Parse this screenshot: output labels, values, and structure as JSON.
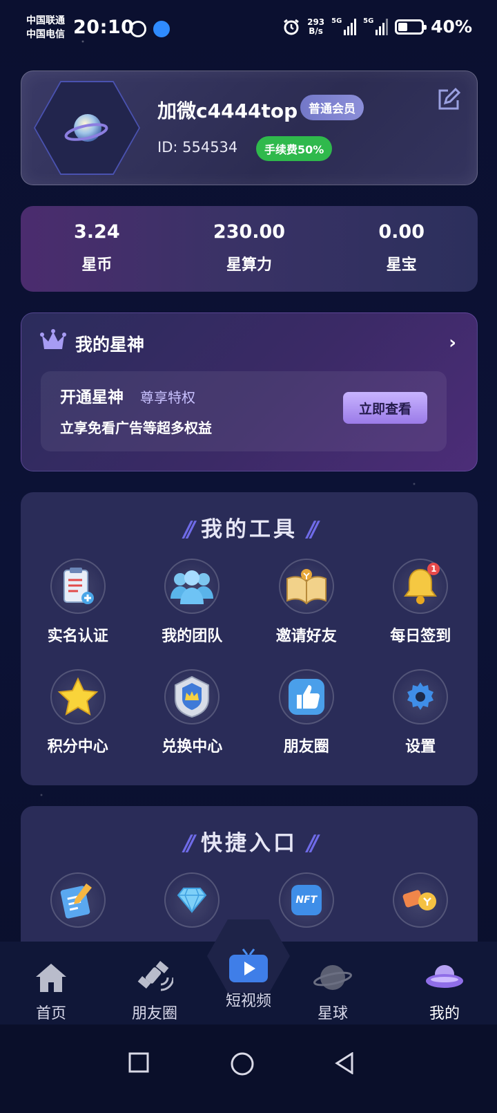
{
  "status_bar": {
    "carrier1": "中国联通",
    "carrier2": "中国电信",
    "time": "20:10",
    "net_speed_value": "293",
    "net_speed_unit": "B/s",
    "signal1_label": "5G",
    "signal2_label": "5G",
    "battery": "40%"
  },
  "profile": {
    "username": "加微c4444top",
    "member_level": "普通会员",
    "user_id": "ID: 554534",
    "fee": "手续费50%"
  },
  "stats": [
    {
      "value": "3.24",
      "label": "星币"
    },
    {
      "value": "230.00",
      "label": "星算力"
    },
    {
      "value": "0.00",
      "label": "星宝"
    }
  ],
  "vip": {
    "title": "我的星神",
    "inner_title": "开通星神",
    "inner_subtitle": "尊享特权",
    "description": "立享免看广告等超多权益",
    "button": "立即查看"
  },
  "tools": {
    "title": "我的工具",
    "items": [
      {
        "label": "实名认证",
        "icon": "clipboard-icon"
      },
      {
        "label": "我的团队",
        "icon": "team-icon"
      },
      {
        "label": "邀请好友",
        "icon": "book-icon"
      },
      {
        "label": "每日签到",
        "icon": "bell-icon",
        "badge": "1"
      },
      {
        "label": "积分中心",
        "icon": "star-icon"
      },
      {
        "label": "兑换中心",
        "icon": "crown-shield-icon"
      },
      {
        "label": "朋友圈",
        "icon": "thumbs-up-icon"
      },
      {
        "label": "设置",
        "icon": "gear-icon"
      }
    ]
  },
  "shortcuts": {
    "title": "快捷入口",
    "items": [
      {
        "icon": "notepad-icon"
      },
      {
        "icon": "diamond-icon"
      },
      {
        "icon": "nft-icon",
        "text": "NFT"
      },
      {
        "icon": "tickets-icon"
      }
    ]
  },
  "tabbar": {
    "items": [
      {
        "label": "首页",
        "icon": "home-icon"
      },
      {
        "label": "朋友圈",
        "icon": "satellite-icon"
      },
      {
        "label": "短视频",
        "icon": "tv-play-icon"
      },
      {
        "label": "星球",
        "icon": "planet-icon"
      },
      {
        "label": "我的",
        "icon": "ufo-icon"
      }
    ],
    "active": "我的"
  },
  "colors": {
    "background": "#0b1030",
    "card": "#2a2c58",
    "accent": "#6f6be8",
    "fee_badge": "#2fb94c"
  }
}
